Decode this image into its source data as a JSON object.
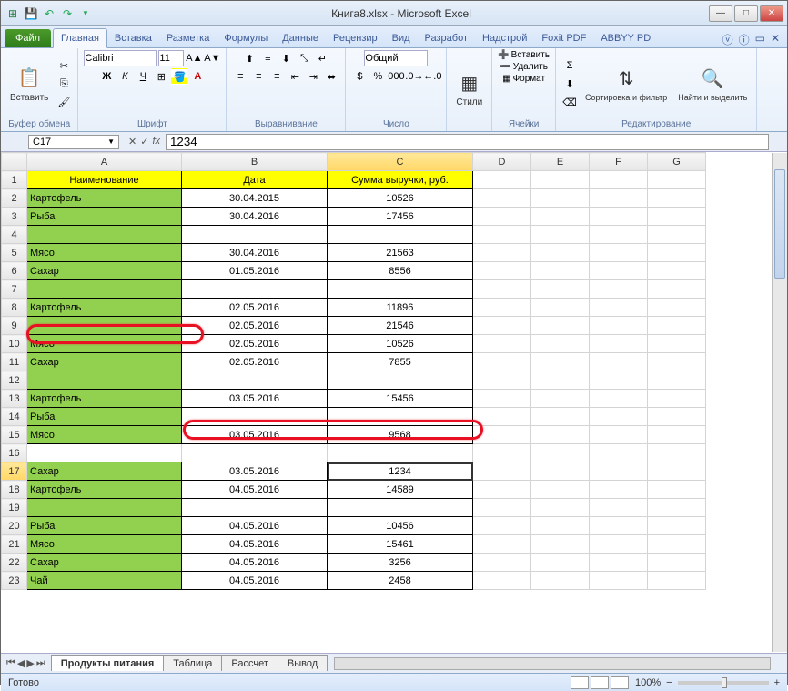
{
  "window": {
    "title": "Книга8.xlsx - Microsoft Excel"
  },
  "ribbon": {
    "file": "Файл",
    "tabs": [
      "Главная",
      "Вставка",
      "Разметка",
      "Формулы",
      "Данные",
      "Рецензир",
      "Вид",
      "Разработ",
      "Надстрой",
      "Foxit PDF",
      "ABBYY PD"
    ],
    "active_tab": "Главная",
    "groups": {
      "clipboard": {
        "paste": "Вставить",
        "label": "Буфер обмена"
      },
      "font": {
        "name": "Calibri",
        "size": "11",
        "label": "Шрифт"
      },
      "alignment": {
        "label": "Выравнивание"
      },
      "number": {
        "format": "Общий",
        "label": "Число"
      },
      "styles": {
        "btn": "Стили",
        "label": ""
      },
      "cells": {
        "insert": "Вставить",
        "delete": "Удалить",
        "format": "Формат",
        "label": "Ячейки"
      },
      "editing": {
        "sort": "Сортировка и фильтр",
        "find": "Найти и выделить",
        "label": "Редактирование"
      }
    }
  },
  "namebox": "C17",
  "formula": "1234",
  "columns": [
    "A",
    "B",
    "C",
    "D",
    "E",
    "F",
    "G"
  ],
  "headers": {
    "A": "Наименование",
    "B": "Дата",
    "C": "Сумма выручки, руб."
  },
  "rows": [
    {
      "n": 1,
      "hdr": true
    },
    {
      "n": 2,
      "a": "Картофель",
      "b": "30.04.2015",
      "c": "10526"
    },
    {
      "n": 3,
      "a": "Рыба",
      "b": "30.04.2016",
      "c": "17456"
    },
    {
      "n": 4,
      "a": "",
      "b": "",
      "c": ""
    },
    {
      "n": 5,
      "a": "Мясо",
      "b": "30.04.2016",
      "c": "21563"
    },
    {
      "n": 6,
      "a": "Сахар",
      "b": "01.05.2016",
      "c": "8556"
    },
    {
      "n": 7,
      "a": "",
      "b": "",
      "c": ""
    },
    {
      "n": 8,
      "a": "Картофель",
      "b": "02.05.2016",
      "c": "11896"
    },
    {
      "n": 9,
      "a": "",
      "b": "02.05.2016",
      "c": "21546"
    },
    {
      "n": 10,
      "a": "Мясо",
      "b": "02.05.2016",
      "c": "10526"
    },
    {
      "n": 11,
      "a": "Сахар",
      "b": "02.05.2016",
      "c": "7855"
    },
    {
      "n": 12,
      "a": "",
      "b": "",
      "c": ""
    },
    {
      "n": 13,
      "a": "Картофель",
      "b": "03.05.2016",
      "c": "15456"
    },
    {
      "n": 14,
      "a": "Рыба",
      "b": "",
      "c": ""
    },
    {
      "n": 15,
      "a": "Мясо",
      "b": "03.05.2016",
      "c": "9568"
    },
    {
      "n": 16,
      "a": "",
      "b": "",
      "c": "",
      "blank": true
    },
    {
      "n": 17,
      "a": "Сахар",
      "b": "03.05.2016",
      "c": "1234",
      "sel": true
    },
    {
      "n": 18,
      "a": "Картофель",
      "b": "04.05.2016",
      "c": "14589"
    },
    {
      "n": 19,
      "a": "",
      "b": "",
      "c": ""
    },
    {
      "n": 20,
      "a": "Рыба",
      "b": "04.05.2016",
      "c": "10456"
    },
    {
      "n": 21,
      "a": "Мясо",
      "b": "04.05.2016",
      "c": "15461"
    },
    {
      "n": 22,
      "a": "Сахар",
      "b": "04.05.2016",
      "c": "3256"
    },
    {
      "n": 23,
      "a": "Чай",
      "b": "04.05.2016",
      "c": "2458"
    }
  ],
  "sheet_tabs": [
    "Продукты питания",
    "Таблица",
    "Рассчет",
    "Вывод"
  ],
  "active_sheet": 0,
  "status": {
    "ready": "Готово",
    "zoom": "100%"
  }
}
